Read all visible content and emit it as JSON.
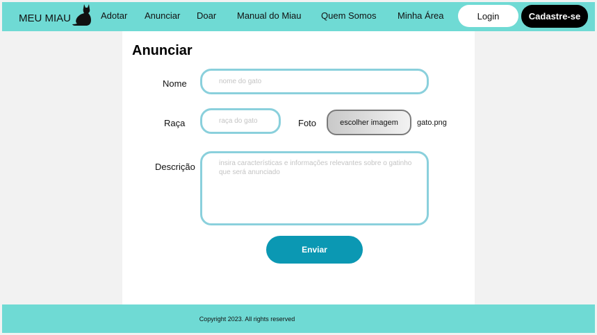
{
  "brand": {
    "name": "MEU MIAU",
    "logo_icon": "cat-silhouette-icon"
  },
  "nav": {
    "items": [
      {
        "label": "Adotar"
      },
      {
        "label": "Anunciar"
      },
      {
        "label": "Doar"
      },
      {
        "label": "Manual do Miau"
      },
      {
        "label": "Quem Somos"
      },
      {
        "label": "Minha Área"
      }
    ],
    "login_label": "Login",
    "signup_label": "Cadastre-se"
  },
  "form": {
    "title": "Anunciar",
    "name_label": "Nome",
    "name_placeholder": "nome do gato",
    "breed_label": "Raça",
    "breed_placeholder": "raça do gato",
    "photo_label": "Foto",
    "photo_button_label": "escolher imagem",
    "photo_filename": "gato.png",
    "description_label": "Descrição",
    "description_placeholder": "insira características e informações relevantes sobre o gatinho que será anunciado",
    "submit_label": "Enviar"
  },
  "footer": {
    "copyright": "Copyright 2023. All rights reserved"
  },
  "colors": {
    "header_bg": "#6fdad4",
    "field_border": "#8ad0dc",
    "submit_bg": "#0b98b3",
    "signup_bg": "#000000",
    "page_bg": "#f2f2f2"
  }
}
